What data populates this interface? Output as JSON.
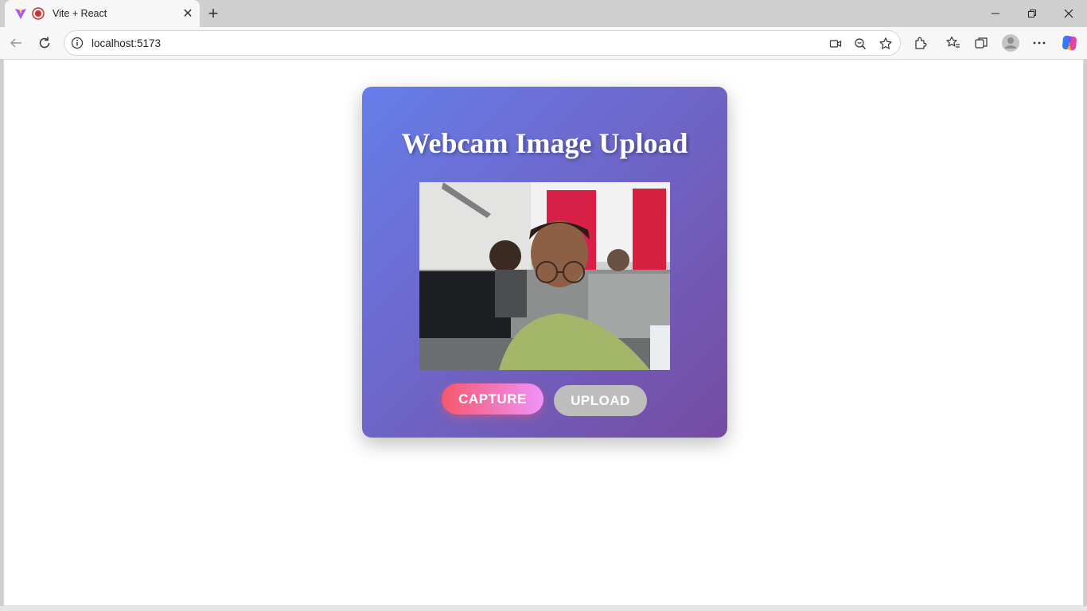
{
  "browser": {
    "tab": {
      "title": "Vite + React",
      "close_label": "✕"
    },
    "new_tab_label": "+",
    "address": {
      "url": "localhost:5173"
    }
  },
  "page": {
    "heading": "Webcam Image Upload",
    "buttons": {
      "capture": "CAPTURE",
      "upload": "UPLOAD"
    }
  },
  "colors": {
    "card_gradient_start": "#667eea",
    "card_gradient_end": "#764ba2",
    "capture_gradient_start": "#f5576c",
    "capture_gradient_end": "#f093fb",
    "upload_bg": "#bdbdbd"
  }
}
